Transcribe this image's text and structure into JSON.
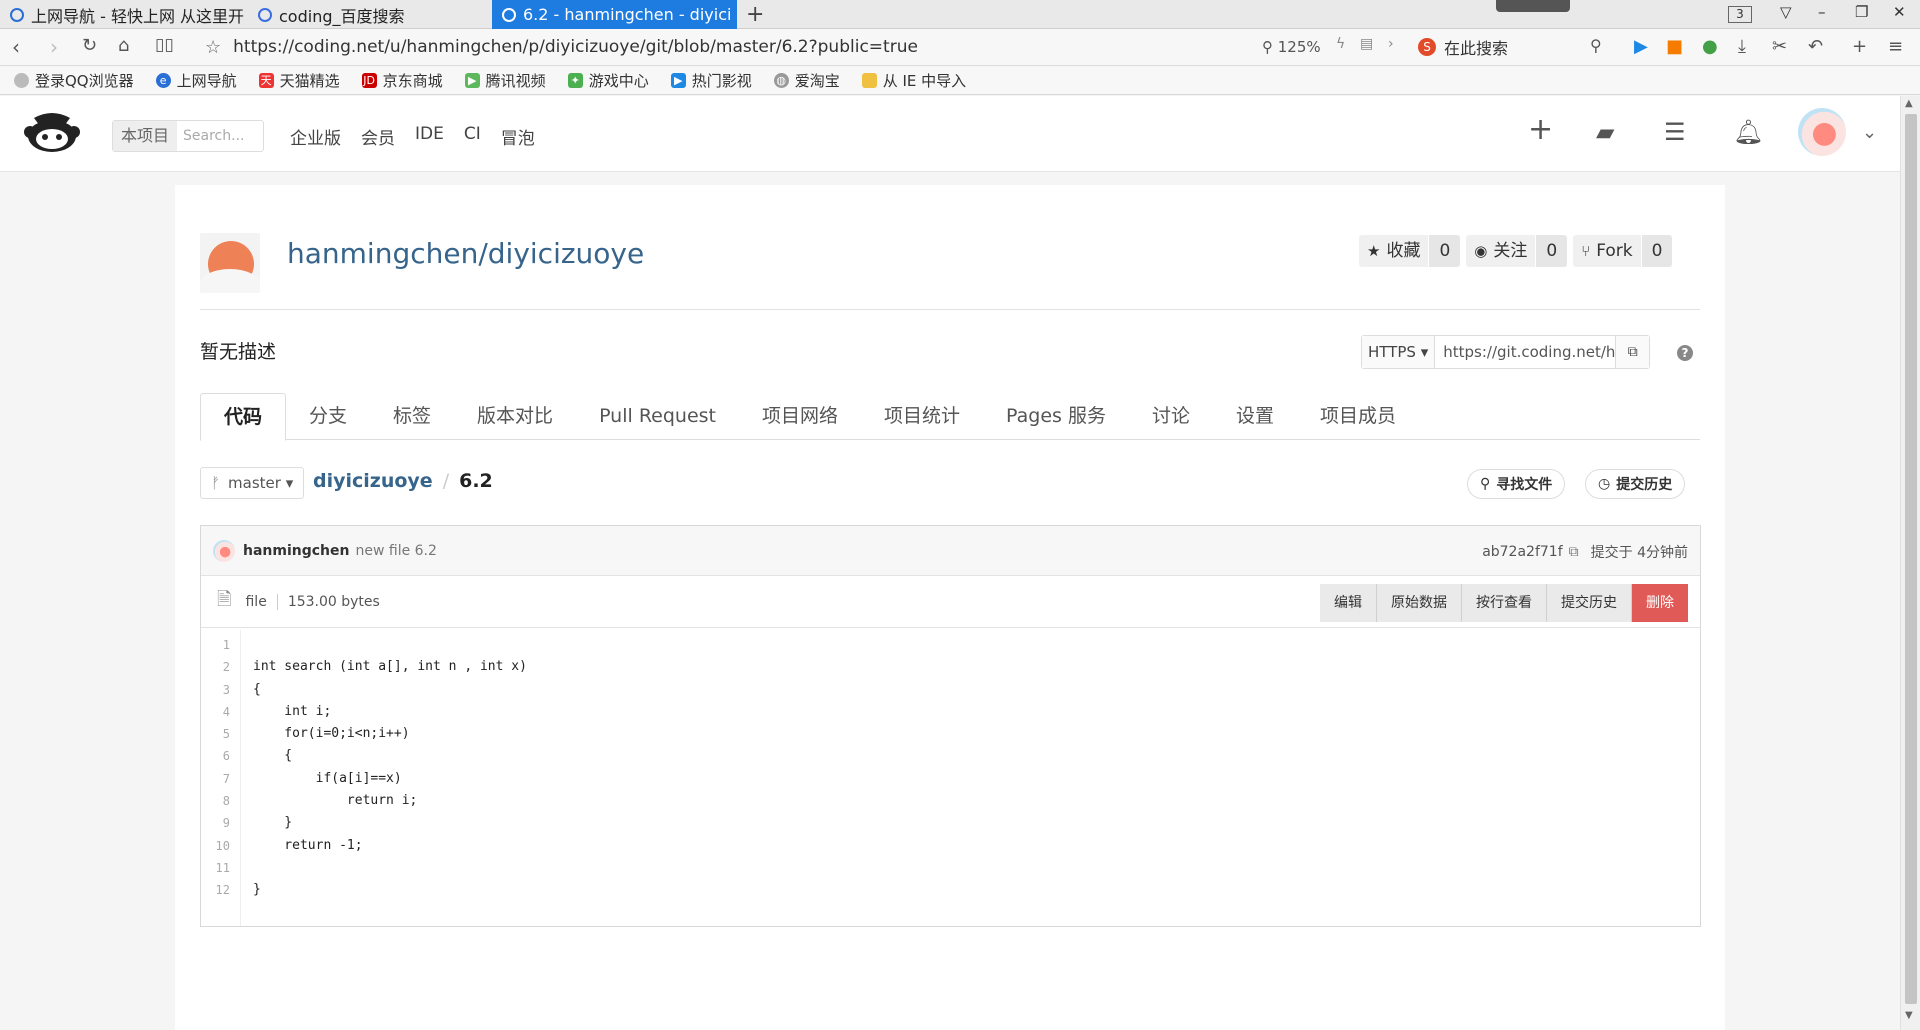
{
  "browser": {
    "tabs": [
      {
        "label": "上网导航 - 轻快上网 从这里开"
      },
      {
        "label": "coding_百度搜索"
      },
      {
        "label": "6.2 - hanmingchen - diyici"
      }
    ],
    "tab_count": "3",
    "url": "https://coding.net/u/hanmingchen/p/diyicizuoye/git/blob/master/6.2?public=true",
    "zoom": "125%",
    "search_placeholder": "在此搜索",
    "bookmarks": [
      "登录QQ浏览器",
      "上网导航",
      "天猫精选",
      "京东商城",
      "腾讯视频",
      "游戏中心",
      "热门影视",
      "爱淘宝",
      "从 IE 中导入"
    ]
  },
  "header": {
    "search_scope": "本项目",
    "search_placeholder": "Search...",
    "nav": [
      "企业版",
      "会员",
      "IDE",
      "CI",
      "冒泡"
    ]
  },
  "project": {
    "title": "hanmingchen/diyicizuoye",
    "counters": [
      {
        "label": "收藏",
        "value": "0",
        "icon": "star-icon"
      },
      {
        "label": "关注",
        "value": "0",
        "icon": "eye-icon"
      },
      {
        "label": "Fork",
        "value": "0",
        "icon": "fork-icon"
      }
    ],
    "description": "暂无描述",
    "clone": {
      "protocol": "HTTPS",
      "url": "https://git.coding.net/hanmingchen/diyicizuoye.git"
    },
    "tabs": [
      "代码",
      "分支",
      "标签",
      "版本对比",
      "Pull Request",
      "项目网络",
      "项目统计",
      "Pages 服务",
      "讨论",
      "设置",
      "项目成员"
    ]
  },
  "file_view": {
    "branch": "master",
    "repo": "diyicizuoye",
    "file": "6.2",
    "find_file": "寻找文件",
    "history": "提交历史",
    "commit": {
      "user": "hanmingchen",
      "message": "new file 6.2",
      "hash": "ab72a2f71f",
      "time": "提交于 4分钟前"
    },
    "type": "file",
    "size": "153.00 bytes",
    "actions": [
      "编辑",
      "原始数据",
      "按行查看",
      "提交历史",
      "删除"
    ],
    "line_numbers": [
      "1",
      "2",
      "3",
      "4",
      "5",
      "6",
      "7",
      "8",
      "9",
      "10",
      "11",
      "12"
    ],
    "code_lines": [
      "",
      "int search (int a[], int n , int x)",
      "{",
      "    int i;",
      "    for(i=0;i<n;i++)",
      "    {",
      "        if(a[i]==x)",
      "            return i;",
      "    }",
      "    return -1;",
      "",
      "}"
    ]
  }
}
